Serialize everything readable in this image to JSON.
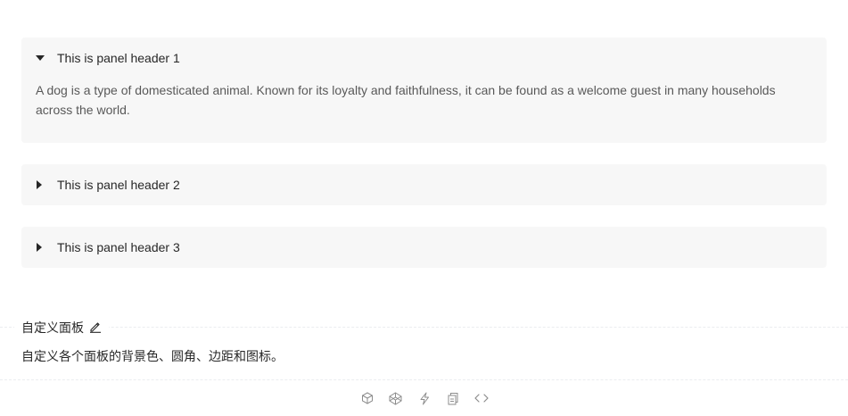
{
  "collapse": {
    "panels": [
      {
        "header": "This is panel header 1",
        "expanded": true,
        "content": "A dog is a type of domesticated animal. Known for its loyalty and faithfulness, it can be found as a welcome guest in many households across the world."
      },
      {
        "header": "This is panel header 2",
        "expanded": false
      },
      {
        "header": "This is panel header 3",
        "expanded": false
      }
    ]
  },
  "demo_meta": {
    "title": "自定义面板",
    "description": "自定义各个面板的背景色、圆角、边距和图标。",
    "edit_icon": "edit-icon"
  },
  "actions": {
    "icons": [
      "codesandbox-icon",
      "codepen-icon",
      "thunderbolt-icon",
      "copy-icon",
      "code-expand-icon"
    ]
  },
  "colors": {
    "panel_bg": "#f7f7f7",
    "divider": "#ebedf0",
    "text": "#262626",
    "icon": "#8c8c8c"
  }
}
